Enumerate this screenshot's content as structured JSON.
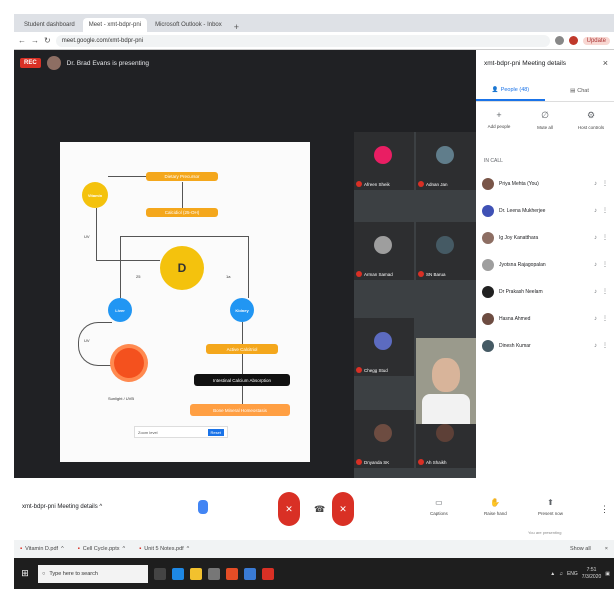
{
  "browser": {
    "tabs": [
      {
        "label": "Student dashboard",
        "active": false
      },
      {
        "label": "Meet - xmt-bdpr-pni",
        "active": true
      },
      {
        "label": "Microsoft Outlook - Inbox",
        "active": false
      }
    ],
    "new_tab_icon": "+",
    "url": "meet.google.com/xmt-bdpr-pni",
    "update_label": "Update"
  },
  "meet": {
    "recording_badge": "REC",
    "presenter_text": "Dr. Brad Evans is presenting",
    "slide": {
      "top_left_node": "Vitamin",
      "top_box": "Dietary Precursor",
      "second_box": "Calcidiol (25-OH)",
      "center_node": "D",
      "left_node": "Liver",
      "right_node": "Kidney",
      "sun_label": "Sunlight / UVB",
      "orange_box": "Active Calcitriol",
      "black_box": "Intestinal Calcium Absorption",
      "bottom_box": "Bone Mineral Homeostasis",
      "left_arrow_label": "UV",
      "arrow_left_label": "25",
      "arrow_right_label": "1a",
      "loop_label": "UV",
      "zoom_text": "Zoom level",
      "zoom_button": "Reset"
    },
    "participants": [
      {
        "name": "Afreen Sheik",
        "color": "#e91e63"
      },
      {
        "name": "Adnan Jan",
        "color": "#607d8b"
      },
      {
        "name": "Arman Samad",
        "color": "#9e9e9e"
      },
      {
        "name": "SN Barua",
        "color": "#455a64"
      },
      {
        "name": "Chegg Stud",
        "color": "#5c6bc0"
      },
      {
        "name": "Dnyanda SK",
        "color": "#6d4c41"
      },
      {
        "name": "Ah Shaikh",
        "color": "#5d4037"
      }
    ]
  },
  "panel": {
    "title": "xmt-bdpr-pni Meeting details",
    "close_icon": "×",
    "tabs": [
      {
        "label": "People (48)",
        "active": true
      },
      {
        "label": "Chat",
        "active": false
      }
    ],
    "actions": [
      {
        "label": "Add people",
        "icon": "+"
      },
      {
        "label": "Mute all",
        "icon": "∅"
      },
      {
        "label": "Host controls",
        "icon": "⚙"
      }
    ],
    "section_label": "IN CALL",
    "people": [
      {
        "name": "Priya Mehta (You)",
        "color": "#795548"
      },
      {
        "name": "Dr. Leena Mukherjee",
        "color": "#3f51b5"
      },
      {
        "name": "Ig Joy Kanatthara",
        "color": "#8d6e63"
      },
      {
        "name": "Jyotsna Rajagopalan",
        "color": "#9e9e9e"
      },
      {
        "name": "Dr Prakash Neelam",
        "color": "#212121"
      },
      {
        "name": "Hasna Ahmed",
        "color": "#6d4c41"
      },
      {
        "name": "Dinesh Kumar",
        "color": "#455a64"
      }
    ]
  },
  "controls": {
    "meeting_info": "xmt-bdpr-pni Meeting details",
    "chevron": "^",
    "mic_icon": "✕",
    "leave_icon": "☎",
    "cam_icon": "✕",
    "more_icon": "⋮",
    "tools": [
      {
        "label": "Captions",
        "icon": "▭"
      },
      {
        "label": "Raise hand",
        "icon": "✋"
      },
      {
        "label": "Present now",
        "icon": "⬆"
      }
    ],
    "presenting_note": "You are presenting"
  },
  "downloads": {
    "items": [
      {
        "label": "Vitamin D.pdf"
      },
      {
        "label": "Cell Cycle.pptx"
      },
      {
        "label": "Unit 5 Notes.pdf"
      }
    ],
    "show_all": "Show all"
  },
  "taskbar": {
    "start_icon": "⊞",
    "search_placeholder": "Type here to search",
    "clock_time": "7:51",
    "clock_date": "7/3/2020",
    "lang": "ENG"
  }
}
